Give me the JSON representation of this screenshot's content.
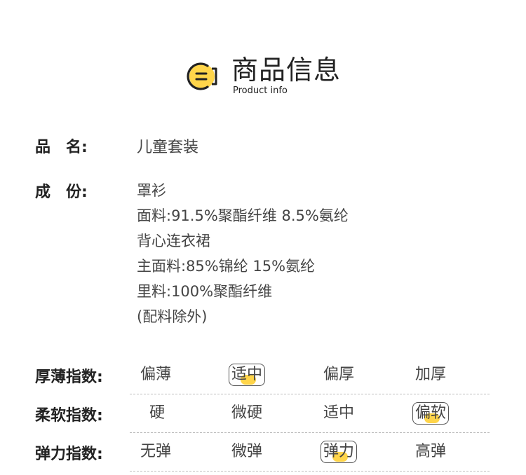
{
  "header": {
    "title_cn": "商品信息",
    "title_en": "Product info",
    "logo_icon": "note-circle-icon",
    "accent_color": "#ffd54a"
  },
  "product": {
    "name_label": "品　名:",
    "name_value": "儿童套装",
    "composition_label": "成　份:",
    "composition_lines": [
      "罩衫",
      "面料:91.5%聚酯纤维 8.5%氨纶",
      "背心连衣裙",
      "主面料:85%锦纶 15%氨纶",
      "里料:100%聚酯纤维",
      "(配料除外)"
    ]
  },
  "scales": [
    {
      "label": "厚薄指数:",
      "options": [
        "偏薄",
        "适中",
        "偏厚",
        "加厚"
      ],
      "selected": "适中"
    },
    {
      "label": "柔软指数:",
      "options": [
        "硬",
        "微硬",
        "适中",
        "偏软"
      ],
      "selected": "偏软"
    },
    {
      "label": "弹力指数:",
      "options": [
        "无弹",
        "微弹",
        "弹力",
        "高弹"
      ],
      "selected": "弹力"
    }
  ]
}
